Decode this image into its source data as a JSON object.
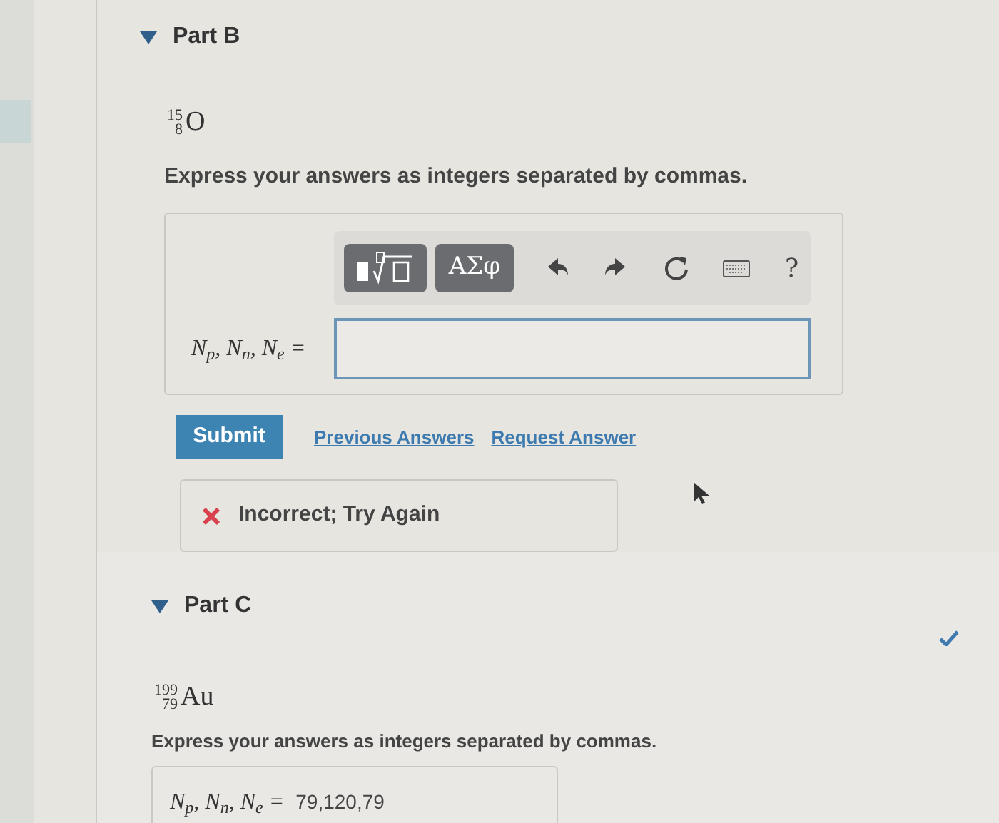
{
  "part_b": {
    "label": "Part B",
    "expanded": true,
    "isotope": {
      "mass": "15",
      "number": "8",
      "symbol": "O"
    },
    "instruction": "Express your answers as integers separated by commas.",
    "toolbar": {
      "symbols_button": "ΑΣφ",
      "help": "?"
    },
    "answer_label": "N$_{p}$, N$_{n}$, N$_{e}$ =",
    "submit": "Submit",
    "links": [
      "Previous Answers",
      "Request Answer"
    ],
    "feedback": {
      "kind": "incorrect",
      "text": "Incorrect; Try Again"
    }
  },
  "part_c": {
    "label": "Part C",
    "expanded": true,
    "correct": true,
    "isotope": {
      "mass": "199",
      "number": "79",
      "symbol": "Au"
    },
    "instruction": "Express your answers as integers separated by commas.",
    "answer_label": "N$_{p}$, N$_{n}$, N$_{e}$ =",
    "answer": "79,120,79"
  }
}
